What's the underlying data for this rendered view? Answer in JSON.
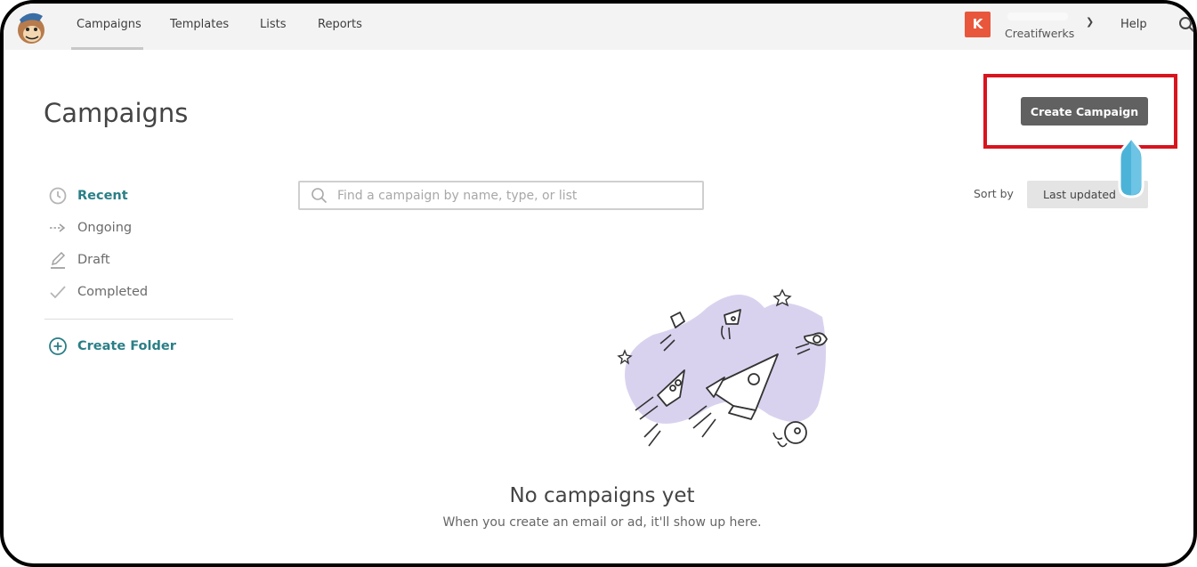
{
  "topbar": {
    "logo": "mailchimp-freddie-logo",
    "nav": [
      {
        "label": "Campaigns",
        "active": true
      },
      {
        "label": "Templates",
        "active": false
      },
      {
        "label": "Lists",
        "active": false
      },
      {
        "label": "Reports",
        "active": false
      }
    ],
    "account": {
      "avatar_letter": "K",
      "avatar_color": "#e8573b",
      "org_name": "Creatifwerks"
    },
    "help_label": "Help"
  },
  "page": {
    "title": "Campaigns",
    "create_button_label": "Create Campaign"
  },
  "sidebar": {
    "items": [
      {
        "label": "Recent",
        "icon": "clock-icon",
        "active": true
      },
      {
        "label": "Ongoing",
        "icon": "dashed-arrow-icon",
        "active": false
      },
      {
        "label": "Draft",
        "icon": "pencil-icon",
        "active": false
      },
      {
        "label": "Completed",
        "icon": "checkmark-icon",
        "active": false
      }
    ],
    "create_folder_label": "Create Folder"
  },
  "search": {
    "placeholder": "Find a campaign by name, type, or list",
    "value": ""
  },
  "sort": {
    "label": "Sort by",
    "selected": "Last updated"
  },
  "empty_state": {
    "title": "No campaigns yet",
    "subtitle": "When you create an email or ad, it'll show up here."
  },
  "colors": {
    "accent_teal": "#2a7f86",
    "highlight_red": "#d8141e",
    "button_gray": "#616161",
    "illustration_purple": "#d9d2ef"
  }
}
